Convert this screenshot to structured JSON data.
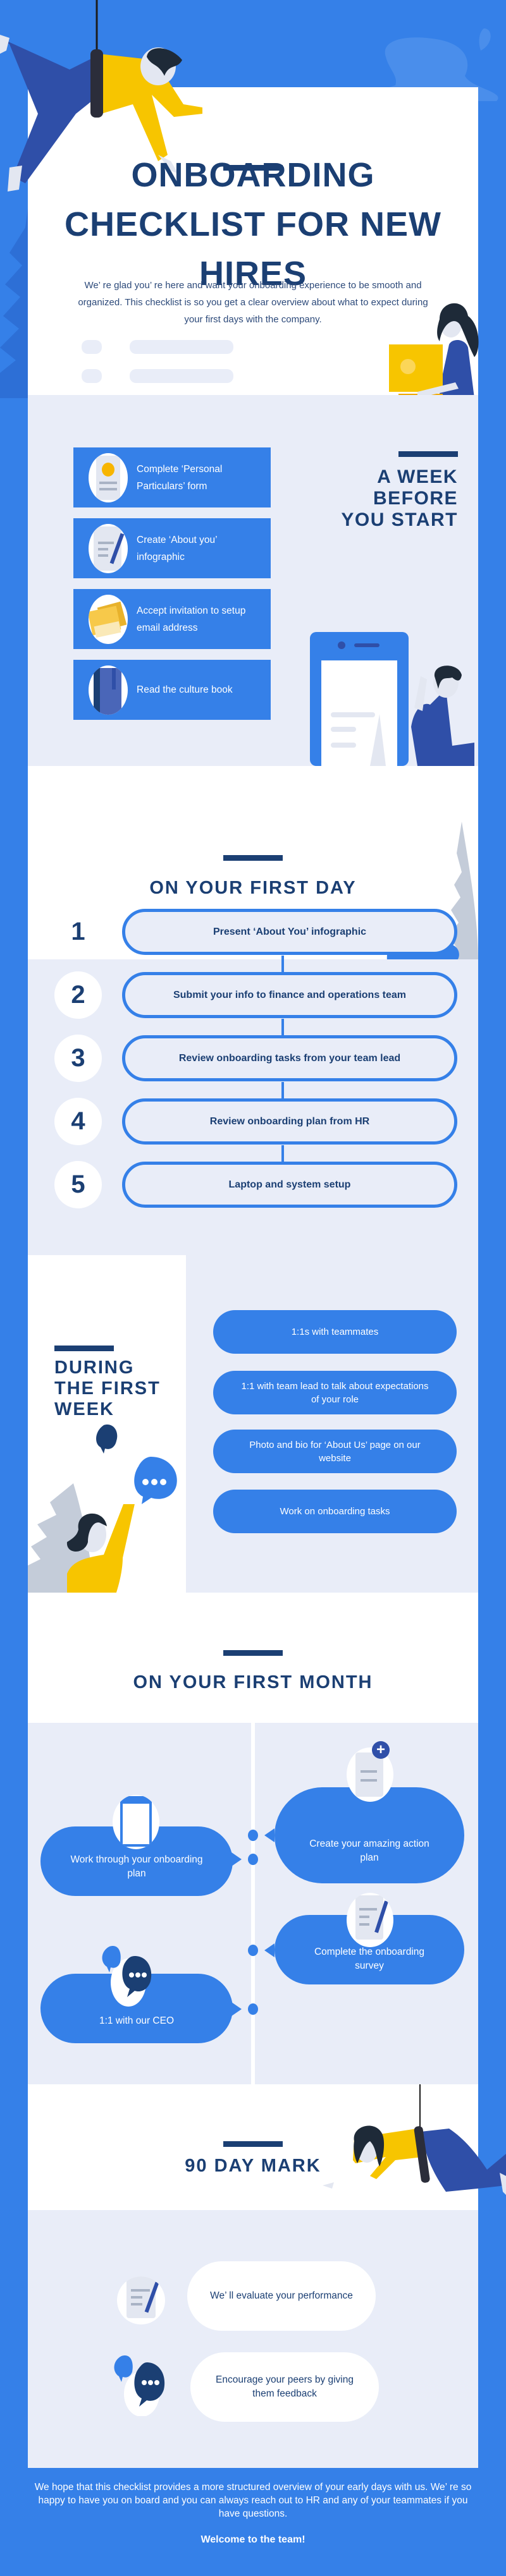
{
  "header": {
    "title": "ONBOARDING CHECKLIST FOR NEW HIRES",
    "intro": "We’ re glad you’ re here and want your onboarding experience to be smooth and organized. This checklist is so you get a clear overview about what to expect during your first days with the company."
  },
  "week_before": {
    "title": "A WEEK BEFORE YOU START",
    "items": [
      {
        "label": "Complete ‘Personal Particulars’ form",
        "icon": "form-icon"
      },
      {
        "label": "Create ‘About you’ infographic",
        "icon": "document-pen-icon"
      },
      {
        "label": "Accept invitation to setup email address",
        "icon": "envelope-icon"
      },
      {
        "label": "Read the culture book",
        "icon": "book-icon"
      }
    ]
  },
  "first_day": {
    "title": "ON YOUR FIRST DAY",
    "steps": [
      {
        "number": "1",
        "label": "Present ‘About You’ infographic"
      },
      {
        "number": "2",
        "label": "Submit your info to finance and operations team"
      },
      {
        "number": "3",
        "label": "Review onboarding tasks from your team lead"
      },
      {
        "number": "4",
        "label": "Review onboarding plan from HR"
      },
      {
        "number": "5",
        "label": "Laptop and system setup"
      }
    ]
  },
  "first_week": {
    "title": "DURING THE FIRST WEEK",
    "items": [
      "1:1s with teammates",
      "1:1 with team lead to talk about expectations of your role",
      "Photo and bio for ‘About Us’ page on our website",
      "Work on onboarding tasks"
    ]
  },
  "first_month": {
    "title": "ON YOUR FIRST MONTH",
    "items": [
      {
        "label": "Create your amazing action plan",
        "icon": "add-document-icon"
      },
      {
        "label": "Work through your onboarding plan",
        "icon": "phone-icon"
      },
      {
        "label": "Complete the onboarding survey",
        "icon": "document-pen-icon"
      },
      {
        "label": "1:1 with our CEO",
        "icon": "chat-bubble-icon"
      }
    ]
  },
  "ninety_day": {
    "title": "90 DAY MARK",
    "items": [
      {
        "label": "We’ ll evaluate your performance",
        "icon": "document-pen-icon"
      },
      {
        "label": "Encourage your peers by giving them feedback",
        "icon": "chat-bubble-icon"
      }
    ]
  },
  "footer": {
    "text": "We hope that this checklist provides a more structured overview of your early days with us. We’ re so happy to have you on board and you can always reach out to HR and any of your teammates if you have questions.",
    "welcome": "Welcome to the team!"
  },
  "colors": {
    "primary_blue": "#3580e8",
    "navy": "#1b3f73",
    "lavender": "#e9edf8",
    "yellow": "#f7c500"
  }
}
